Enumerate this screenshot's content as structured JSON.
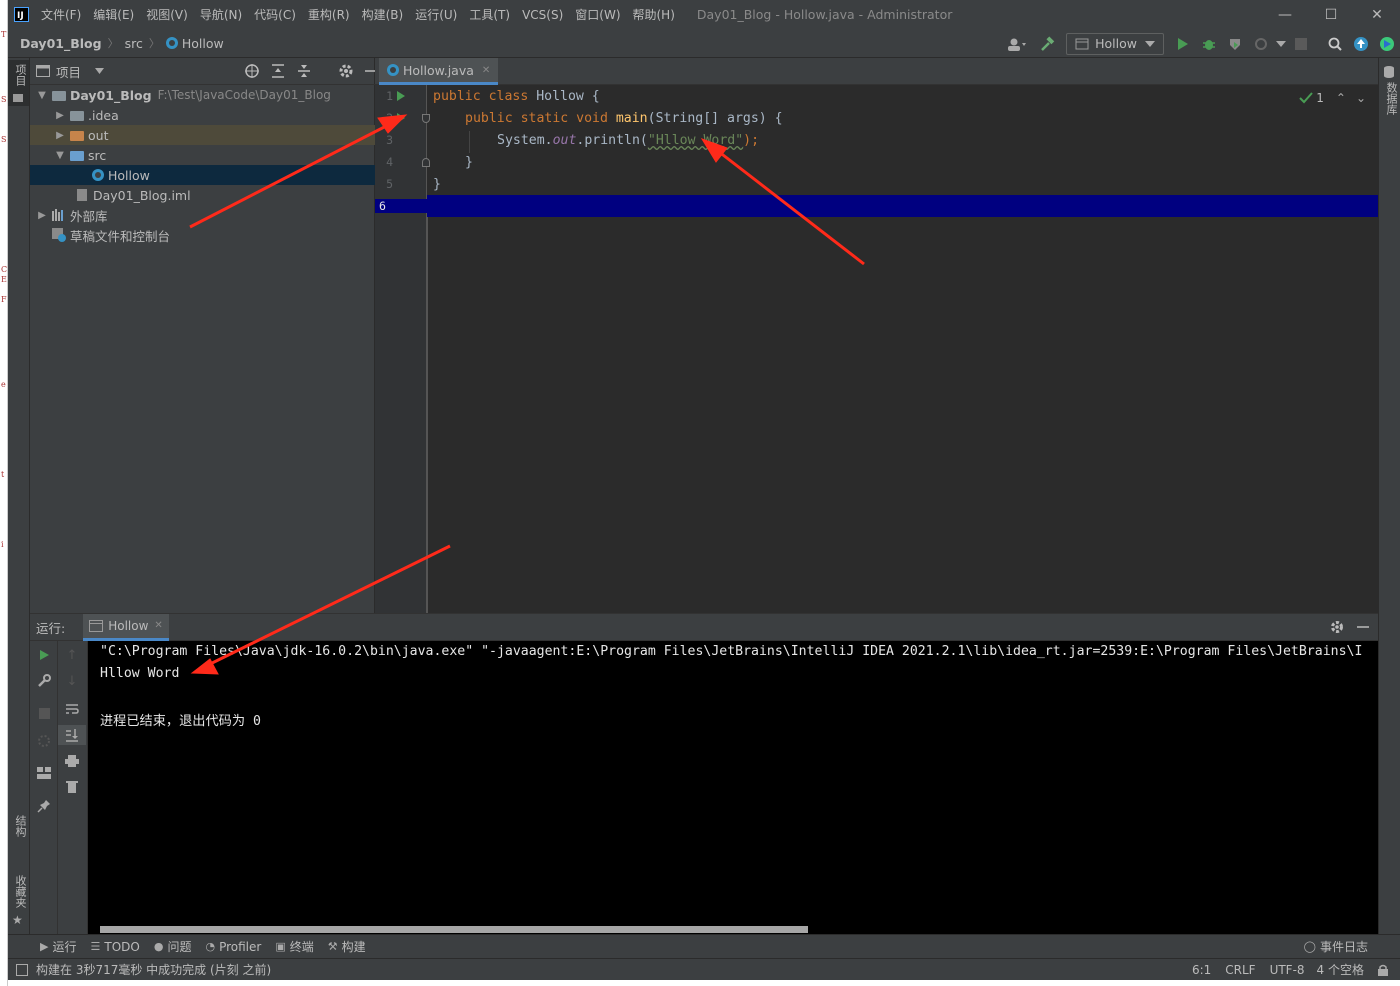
{
  "menubar": {
    "logo": "IJ",
    "items": [
      "文件(F)",
      "编辑(E)",
      "视图(V)",
      "导航(N)",
      "代码(C)",
      "重构(R)",
      "构建(B)",
      "运行(U)",
      "工具(T)",
      "VCS(S)",
      "窗口(W)",
      "帮助(H)"
    ],
    "window_title": "Day01_Blog - Hollow.java - Administrator",
    "minimize": "—",
    "maximize": "☐",
    "close": "✕"
  },
  "navbar": {
    "crumbs": [
      "Day01_Blog",
      "src",
      "Hollow"
    ],
    "separator": "〉",
    "run_config": "Hollow"
  },
  "sidetabs": {
    "project": "项目",
    "structure": "结构",
    "favorites": "收藏夹",
    "database": "数据库"
  },
  "project_panel": {
    "title": "项目",
    "tree": [
      {
        "label": "Day01_Blog",
        "path": "F:\\Test\\JavaCode\\Day01_Blog"
      },
      {
        "label": ".idea"
      },
      {
        "label": "out"
      },
      {
        "label": "src"
      },
      {
        "label": "Hollow"
      },
      {
        "label": "Day01_Blog.iml"
      },
      {
        "label": "外部库"
      },
      {
        "label": "草稿文件和控制台"
      }
    ]
  },
  "editor": {
    "tab_label": "Hollow.java",
    "line_numbers": [
      "1",
      "2",
      "3",
      "4",
      "5",
      "6"
    ],
    "code": {
      "l1_kw": "public class ",
      "l1_name": "Hollow {",
      "l2_kw": "public static void ",
      "l2_fn": "main",
      "l2_rest": "(String[] args) {",
      "l3_pre": "System.",
      "l3_out": "out",
      "l3_mid": ".println(",
      "l3_str": "\"Hllow Word\"",
      "l3_end": ");",
      "l4": "}",
      "l5": "}"
    },
    "inspection_count": "1"
  },
  "run_panel": {
    "label": "运行:",
    "tab": "Hollow",
    "console": [
      "\"C:\\Program Files\\Java\\jdk-16.0.2\\bin\\java.exe\" \"-javaagent:E:\\Program Files\\JetBrains\\IntelliJ IDEA 2021.2.1\\lib\\idea_rt.jar=2539:E:\\Program Files\\JetBrains\\I",
      "Hllow Word",
      "",
      "进程已结束，退出代码为 0"
    ]
  },
  "bottom_tabs": [
    {
      "icon": "play-icon",
      "label": "运行"
    },
    {
      "icon": "list-icon",
      "label": "TODO"
    },
    {
      "icon": "info-icon",
      "label": "问题"
    },
    {
      "icon": "profiler-icon",
      "label": "Profiler"
    },
    {
      "icon": "terminal-icon",
      "label": "终端"
    },
    {
      "icon": "hammer-icon",
      "label": "构建"
    }
  ],
  "event_log": "事件日志",
  "statusbar": {
    "message": "构建在 3秒717毫秒 中成功完成 (片刻 之前)",
    "position": "6:1",
    "line_sep": "CRLF",
    "encoding": "UTF-8",
    "indent": "4 个空格"
  },
  "colors": {
    "accent": "#4a88c7",
    "arrow": "#ff2a1a",
    "run_green": "#499c54"
  }
}
